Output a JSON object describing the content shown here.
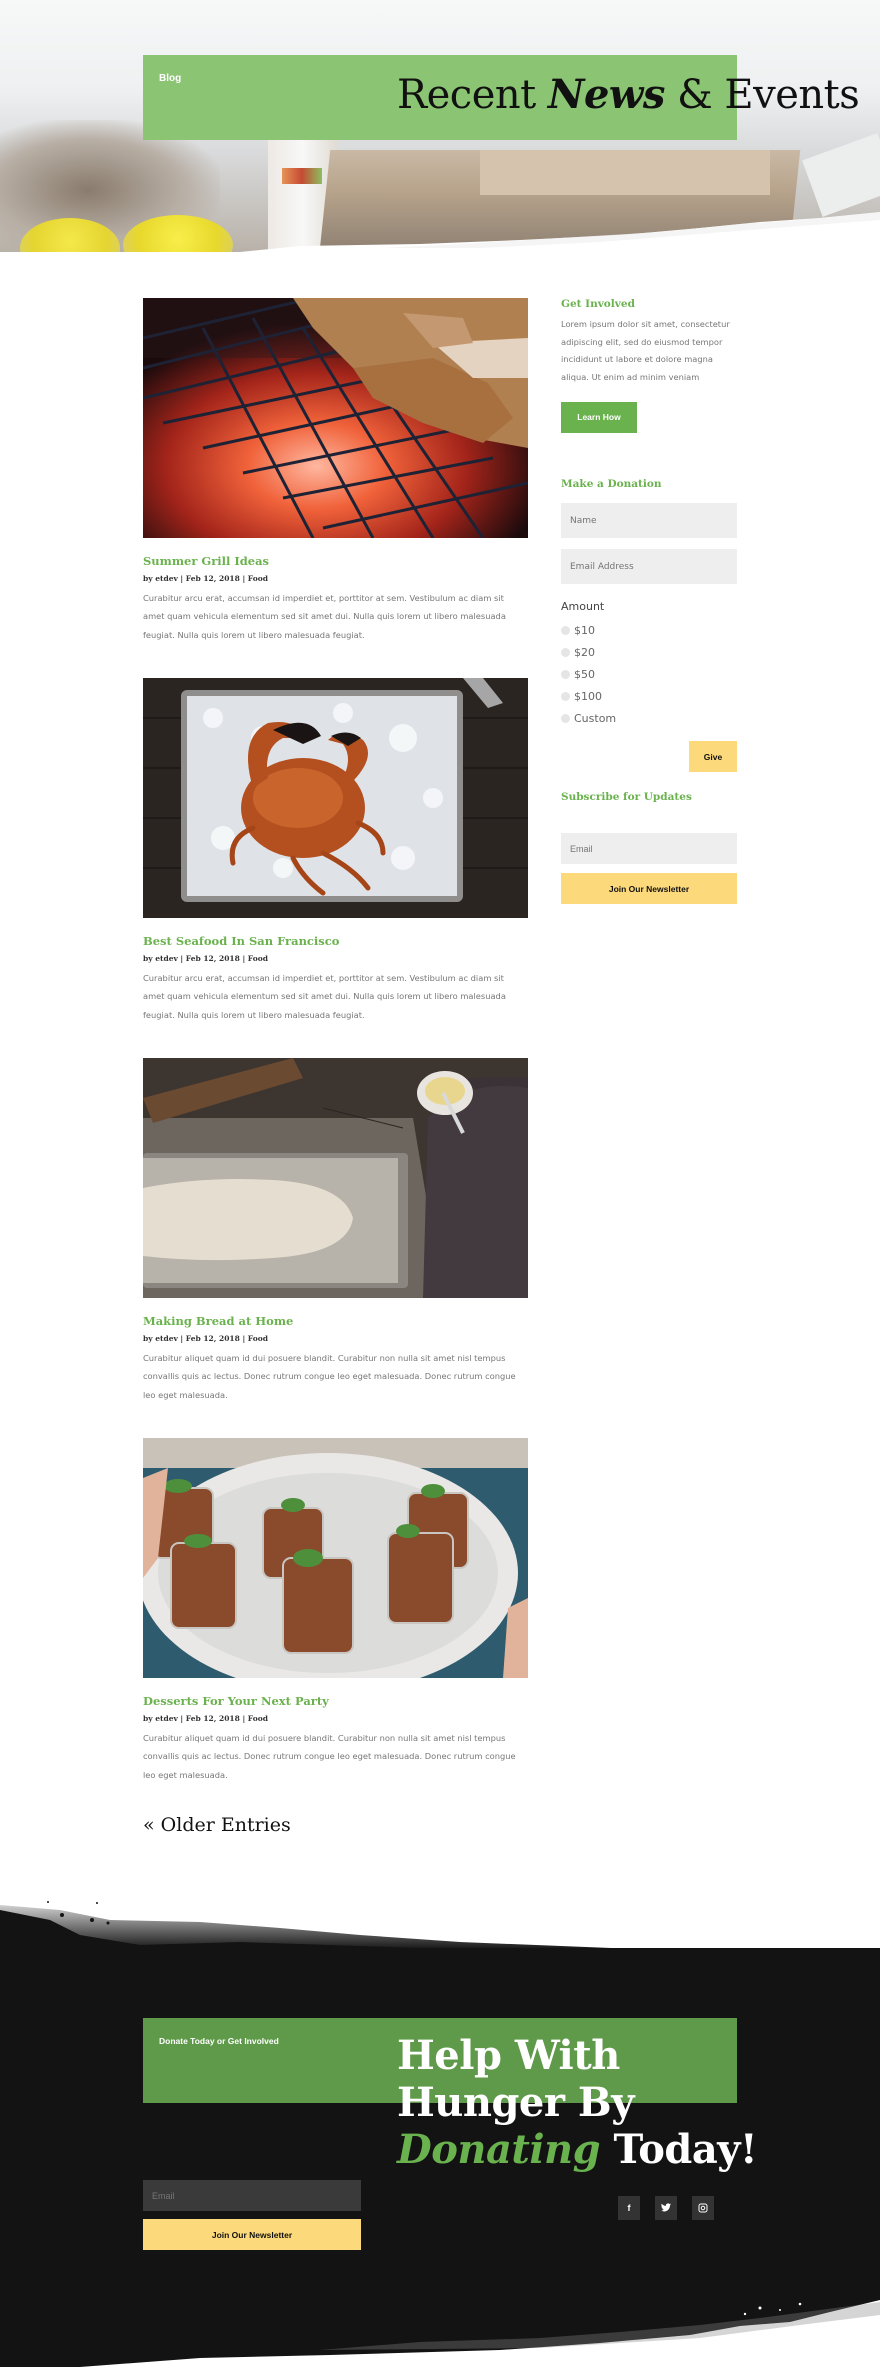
{
  "hero": {
    "breadcrumb": "Blog",
    "title_pre": "Recent ",
    "title_bold": "News",
    "title_post": " & Events",
    "band_color": "#8bc574"
  },
  "posts": [
    {
      "title": "Summer Grill Ideas",
      "meta": "by etdev | Feb 12, 2018 | Food",
      "excerpt": "Curabitur arcu erat, accumsan id imperdiet et, porttitor at sem. Vestibulum ac diam sit amet quam vehicula elementum sed sit amet dui. Nulla quis lorem ut libero malesuada feugiat. Nulla quis lorem ut libero malesuada feugiat.",
      "image": "grill-photo"
    },
    {
      "title": "Best Seafood In San Francisco",
      "meta": "by etdev | Feb 12, 2018 | Food",
      "excerpt": "Curabitur arcu erat, accumsan id imperdiet et, porttitor at sem. Vestibulum ac diam sit amet quam vehicula elementum sed sit amet dui. Nulla quis lorem ut libero malesuada feugiat. Nulla quis lorem ut libero malesuada feugiat.",
      "image": "crab-photo"
    },
    {
      "title": "Making Bread at Home",
      "meta": "by etdev | Feb 12, 2018 | Food",
      "excerpt": "Curabitur aliquet quam id dui posuere blandit. Curabitur non nulla sit amet nisl tempus convallis quis ac lectus. Donec rutrum congue leo eget malesuada. Donec rutrum congue leo eget malesuada.",
      "image": "bread-photo"
    },
    {
      "title": "Desserts For Your Next Party",
      "meta": "by etdev | Feb 12, 2018 | Food",
      "excerpt": "Curabitur aliquet quam id dui posuere blandit. Curabitur non nulla sit amet nisl tempus convallis quis ac lectus. Donec rutrum congue leo eget malesuada. Donec rutrum congue leo eget malesuada.",
      "image": "dessert-photo"
    }
  ],
  "pagination": {
    "older_label": "« Older Entries"
  },
  "sidebar": {
    "get_involved": {
      "title": "Get Involved",
      "text": "Lorem ipsum dolor sit amet, consectetur adipiscing elit, sed do eiusmod tempor incididunt ut labore et dolore magna aliqua. Ut enim ad minim veniam",
      "button": "Learn How"
    },
    "donation": {
      "title": "Make a Donation",
      "name_placeholder": "Name",
      "email_placeholder": "Email Address",
      "amount_label": "Amount",
      "options": [
        "$10",
        "$20",
        "$50",
        "$100",
        "Custom"
      ],
      "give_button": "Give"
    },
    "subscribe": {
      "title": "Subscribe for Updates",
      "email_placeholder": "Email",
      "button": "Join Our Newsletter"
    }
  },
  "footer": {
    "breadcrumb": "Donate Today or Get Involved",
    "title_line1": "Help With",
    "title_bold2": "Hunger",
    "title_by": " By",
    "title_green": "Donating",
    "title_end": " Today!",
    "email_placeholder": "Email",
    "join_button": "Join Our Newsletter",
    "social": [
      {
        "name": "facebook",
        "glyph": "f"
      },
      {
        "name": "twitter",
        "glyph": "t"
      },
      {
        "name": "instagram",
        "glyph": "◎"
      }
    ]
  },
  "colors": {
    "accent_green": "#6ab24e",
    "light_green": "#8bc574",
    "dark_green": "#5f9a4a",
    "yellow": "#fcd97a",
    "footer_bg": "#131313"
  }
}
